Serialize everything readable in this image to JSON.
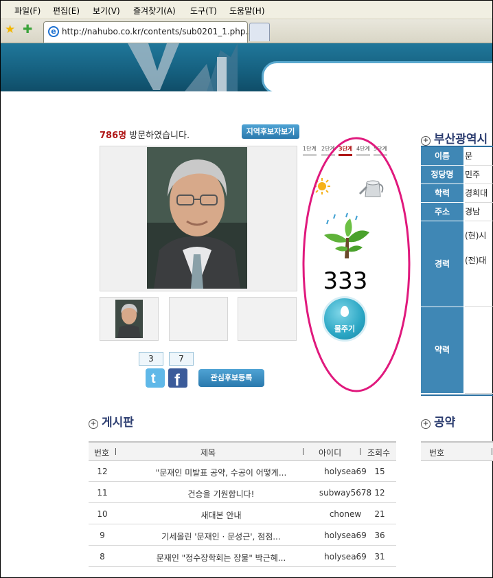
{
  "menu": [
    "파일(F)",
    "편집(E)",
    "보기(V)",
    "즐겨찾기(A)",
    "도구(T)",
    "도움말(H)"
  ],
  "tab": {
    "url": "http://nahubo.co.kr/contents/sub0201_1.php..."
  },
  "profile": {
    "visitor_count": "786명",
    "visitor_text": " 방문하였습니다.",
    "region_button": "지역후보자보기",
    "twitter_count": "3",
    "facebook_count": "7",
    "register_button": "관심후보등록"
  },
  "water": {
    "stages": [
      "1단계",
      "2단계",
      "3단계",
      "4단계",
      "5단계"
    ],
    "current_stage": 3,
    "count": "333",
    "button_label": "물주기"
  },
  "info": {
    "title": "부산광역시",
    "rows": [
      {
        "label": "이름",
        "value": "문"
      },
      {
        "label": "정당명",
        "value": "민주"
      },
      {
        "label": "학력",
        "value": "경희대"
      },
      {
        "label": "주소",
        "value": "경남"
      },
      {
        "label": "경력",
        "value": "(현)시"
      },
      {
        "label": "약력",
        "value": ""
      }
    ],
    "career_second": "(전)대"
  },
  "board": {
    "title": "게시판",
    "headers": [
      "번호",
      "제목",
      "아이디",
      "조회수"
    ],
    "rows": [
      {
        "no": "12",
        "title": "\"문재인 미발표 공약, 수공이 어떻게...",
        "id": "holysea69",
        "views": "15"
      },
      {
        "no": "11",
        "title": "건승을 기원합니다!",
        "id": "subway5678",
        "views": "12"
      },
      {
        "no": "10",
        "title": "새대본 안내",
        "id": "chonew",
        "views": "21"
      },
      {
        "no": "9",
        "title": "기세올린 '문재인 · 문성근', 점점...",
        "id": "holysea69",
        "views": "36"
      },
      {
        "no": "8",
        "title": "문재인 \"정수장학회는 장물\" 박근혜...",
        "id": "holysea69",
        "views": "31"
      }
    ]
  },
  "pledge": {
    "title": "공약",
    "header_no": "번호"
  },
  "colors": {
    "accent_blue": "#3f87b5",
    "highlight_ring": "#e0197d",
    "count_red": "#b01818",
    "active_stage": "#b01818"
  }
}
